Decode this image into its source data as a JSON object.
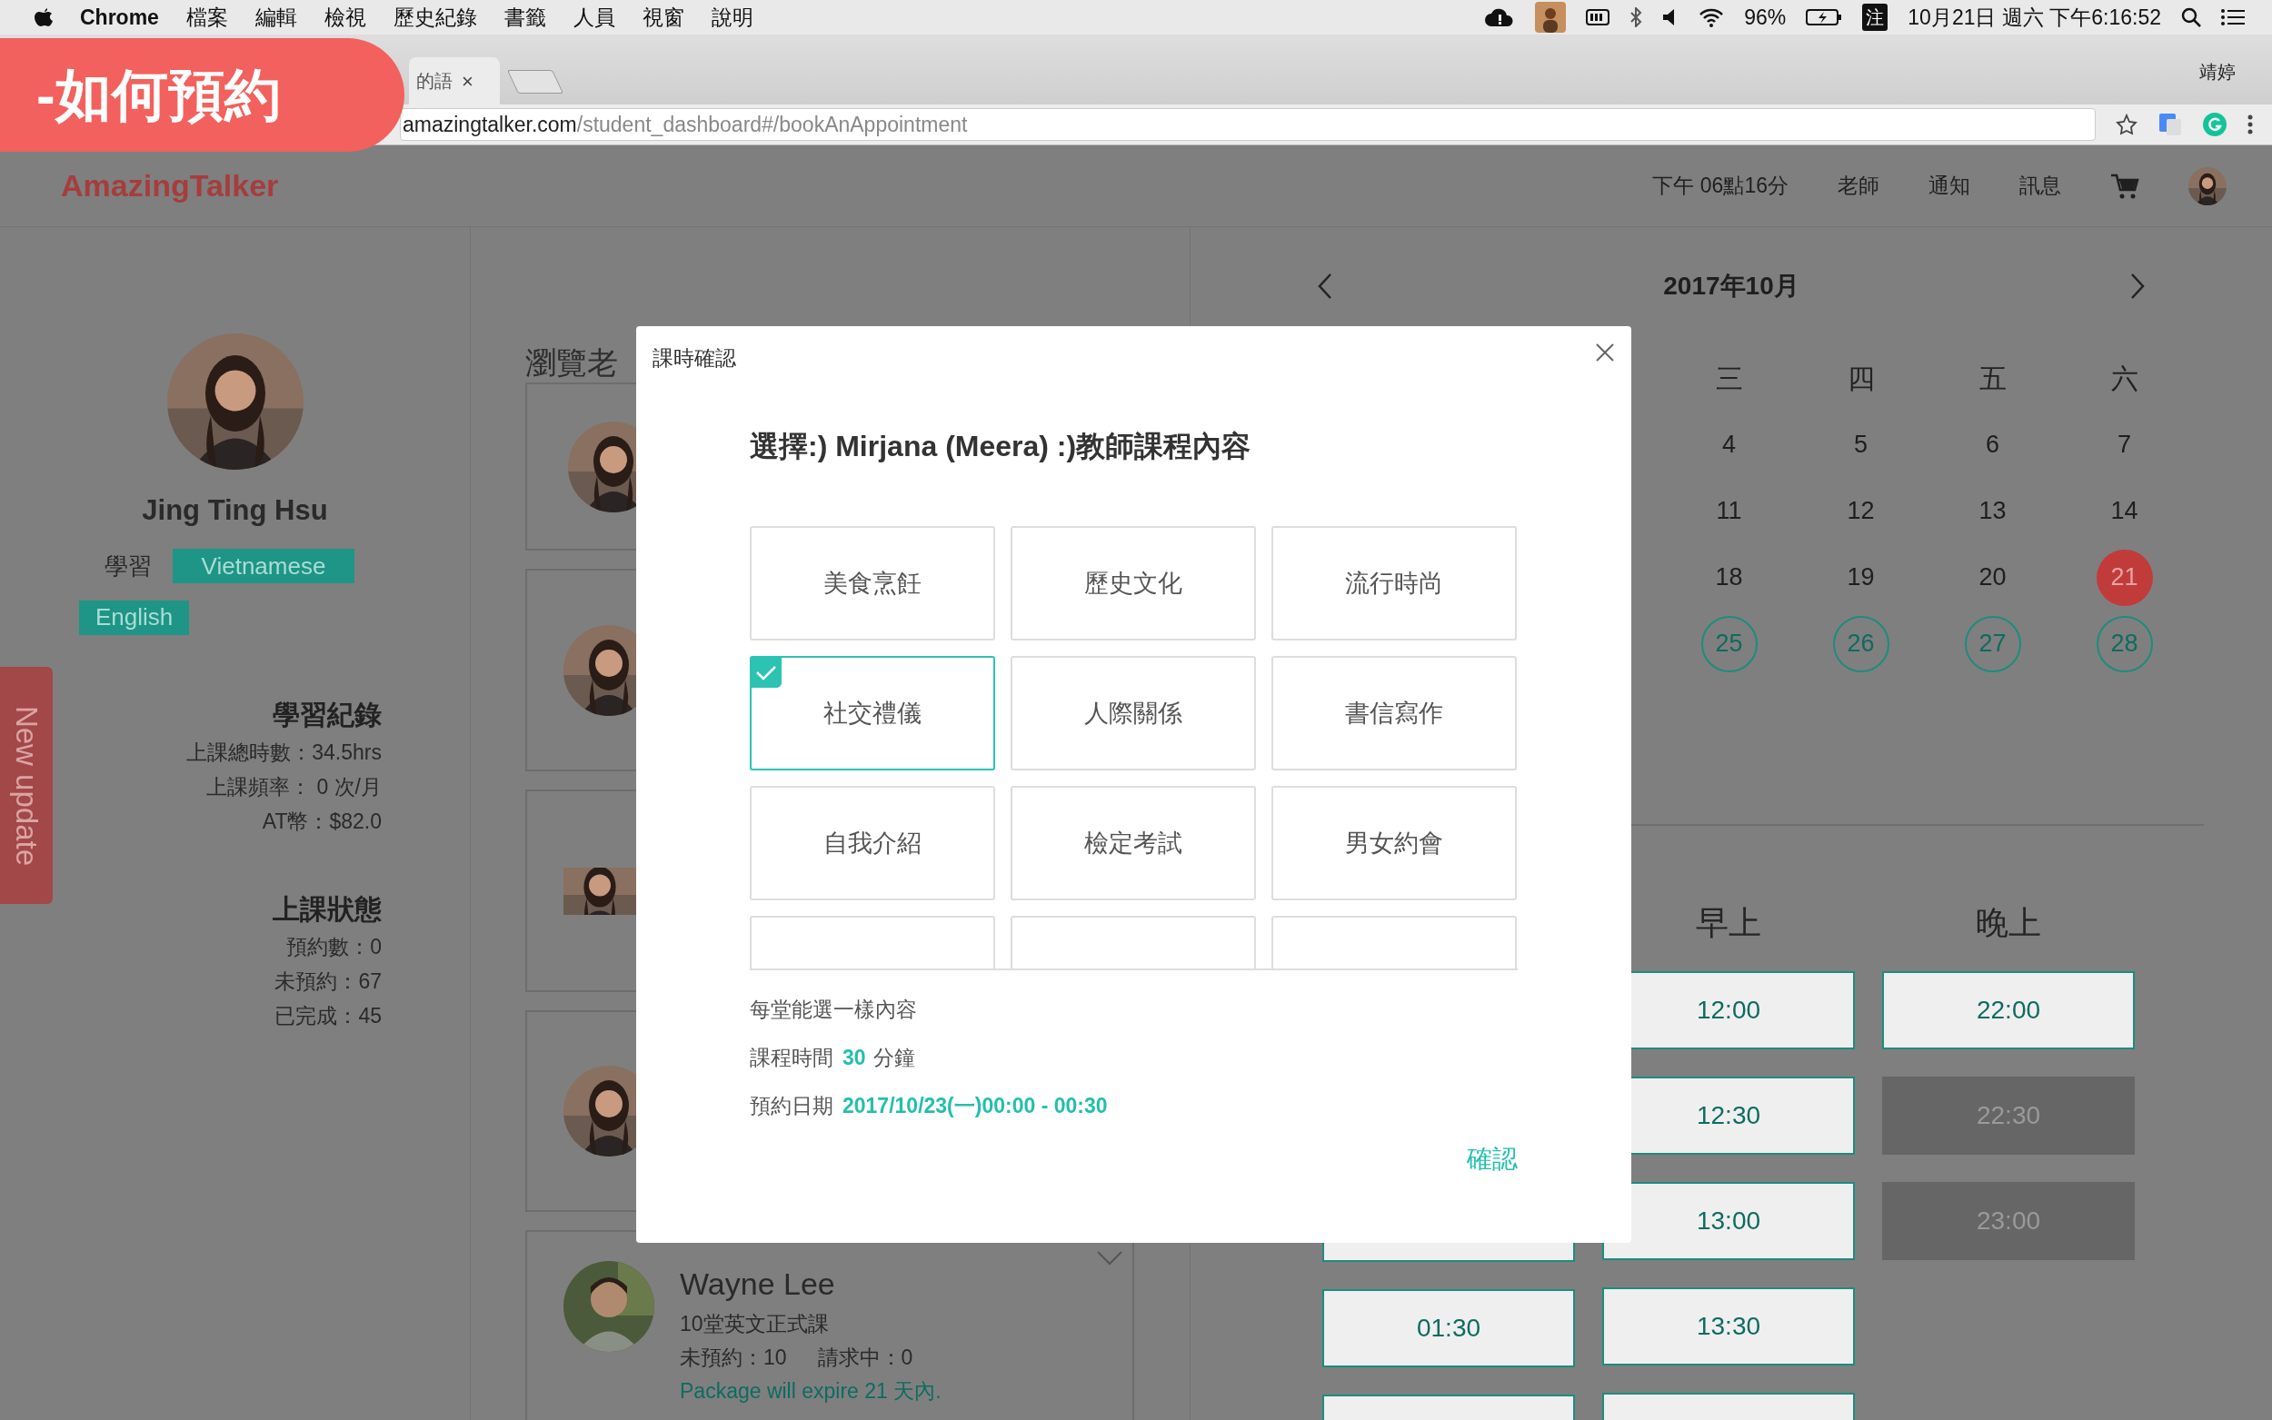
{
  "banner": {
    "text": "-如何預約"
  },
  "menubar": {
    "app": "Chrome",
    "menus": [
      "檔案",
      "編輯",
      "檢視",
      "歷史紀錄",
      "書籤",
      "人員",
      "視窗",
      "說明"
    ],
    "battery_percent": "96%",
    "input_method": "注",
    "clock": "10月21日 週六 下午6:16:52"
  },
  "browser": {
    "tab": {
      "title": "的語",
      "close": "×"
    },
    "profile": "靖婷",
    "url_host": "amazingtalker.com",
    "url_path": "/student_dashboard#/bookAnAppointment"
  },
  "header": {
    "logo": "AmazingTalker",
    "time": "下午 06點16分",
    "nav": [
      "老師",
      "通知",
      "訊息"
    ]
  },
  "new_update_tab": "New update",
  "profile": {
    "name": "Jing Ting Hsu",
    "learning_label": "學習",
    "languages": [
      "Vietnamese",
      "English"
    ],
    "sections": [
      {
        "title": "學習紀錄",
        "lines": [
          "上課總時數：34.5hrs",
          "上課頻率： 0 次/月",
          "AT幣：$82.0"
        ]
      },
      {
        "title": "上課狀態",
        "lines": [
          "預約數：0",
          "未預約：67",
          "已完成：45"
        ]
      }
    ]
  },
  "teachers": {
    "heading": "瀏覽老",
    "cards": [
      {
        "kind": "picture"
      },
      {
        "kind": "picture"
      },
      {
        "kind": "picture"
      },
      {
        "kind": "picture"
      },
      {
        "kind": "picture",
        "name": "Wayne Lee",
        "course": "10堂英文正式課",
        "unbooked": "未預約：10",
        "requesting": "請求中：0",
        "expiry": "Package will expire 21 天內.",
        "expanded": false
      }
    ]
  },
  "calendar": {
    "title": "2017年10月",
    "weekdays": [
      "三",
      "四",
      "五",
      "六"
    ],
    "weeks": [
      [
        {
          "day": "4",
          "today": false,
          "available": false
        },
        {
          "day": "5",
          "today": false,
          "available": false
        },
        {
          "day": "6",
          "today": false,
          "available": false
        },
        {
          "day": "7",
          "today": false,
          "available": false
        }
      ],
      [
        {
          "day": "11",
          "today": false,
          "available": false
        },
        {
          "day": "12",
          "today": false,
          "available": false
        },
        {
          "day": "13",
          "today": false,
          "available": false
        },
        {
          "day": "14",
          "today": false,
          "available": false
        }
      ],
      [
        {
          "day": "18",
          "today": false,
          "available": false
        },
        {
          "day": "19",
          "today": false,
          "available": false
        },
        {
          "day": "20",
          "today": false,
          "available": false
        },
        {
          "day": "21",
          "today": true,
          "available": false
        }
      ],
      [
        {
          "day": "25",
          "today": false,
          "available": true
        },
        {
          "day": "26",
          "today": false,
          "available": true
        },
        {
          "day": "27",
          "today": false,
          "available": true
        },
        {
          "day": "28",
          "today": false,
          "available": true
        }
      ]
    ]
  },
  "time_slots": {
    "columns": [
      {
        "slots": [
          {
            "disabled": false
          },
          {
            "time": "01:30",
            "disabled": false
          },
          {
            "disabled": false
          }
        ]
      },
      {
        "heading": "早上",
        "slots": [
          {
            "time": "12:00",
            "disabled": false
          },
          {
            "time": "12:30",
            "disabled": false
          },
          {
            "time": "13:00",
            "disabled": false
          },
          {
            "time": "13:30",
            "disabled": false
          },
          {
            "disabled": false
          }
        ]
      },
      {
        "heading": "晚上",
        "slots": [
          {
            "time": "22:00",
            "disabled": false
          },
          {
            "time": "22:30",
            "disabled": true
          },
          {
            "time": "23:00",
            "disabled": true
          }
        ]
      }
    ]
  },
  "modal": {
    "title": "課時確認",
    "heading": "選擇:) Mirjana (Meera) :)教師課程內容",
    "topics": [
      {
        "label": "美食烹飪",
        "selected": false
      },
      {
        "label": "歷史文化",
        "selected": false
      },
      {
        "label": "流行時尚",
        "selected": false
      },
      {
        "label": "社交禮儀",
        "selected": true
      },
      {
        "label": "人際關係",
        "selected": false
      },
      {
        "label": "書信寫作",
        "selected": false
      },
      {
        "label": "自我介紹",
        "selected": false
      },
      {
        "label": "檢定考試",
        "selected": false
      },
      {
        "label": "男女約會",
        "selected": false
      },
      {
        "selected": false
      },
      {
        "selected": false
      },
      {
        "selected": false
      }
    ],
    "note": "每堂能選一樣內容",
    "duration": {
      "label": "課程時間",
      "value": "30",
      "unit": "分鐘"
    },
    "date": {
      "label": "預約日期",
      "value": "2017/10/23(一)00:00 - 00:30"
    },
    "confirm": "確認"
  }
}
